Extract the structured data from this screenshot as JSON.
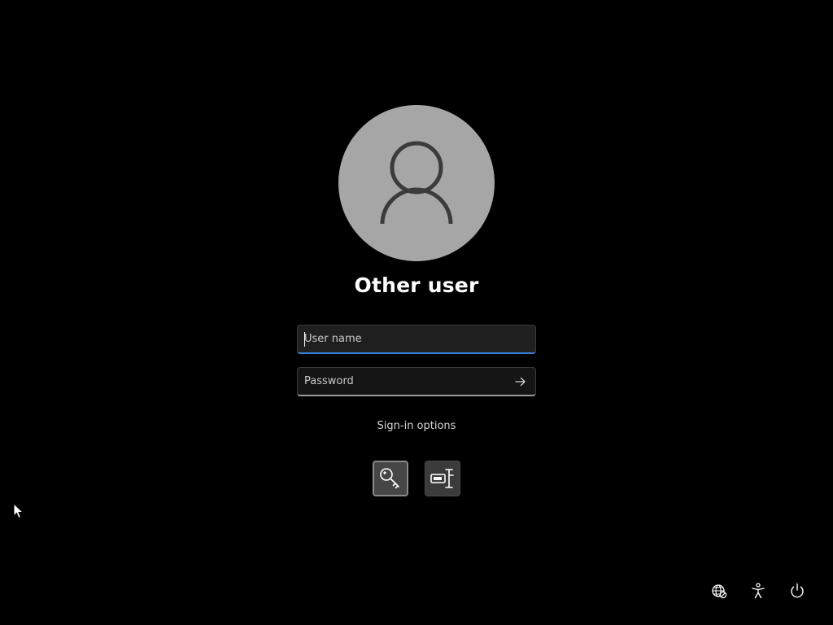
{
  "login": {
    "title": "Other user",
    "username_placeholder": "User name",
    "password_placeholder": "Password",
    "signin_options_label": "Sign-in options",
    "signin_methods": [
      {
        "icon": "key-icon",
        "selected": true
      },
      {
        "icon": "security-key-icon",
        "selected": false
      }
    ]
  },
  "bottom_bar": {
    "icons": [
      "network-icon",
      "accessibility-icon",
      "power-icon"
    ]
  },
  "colors": {
    "background": "#000000",
    "avatar_bg": "#a6a6a6",
    "focus_accent": "#3c7fd6"
  }
}
